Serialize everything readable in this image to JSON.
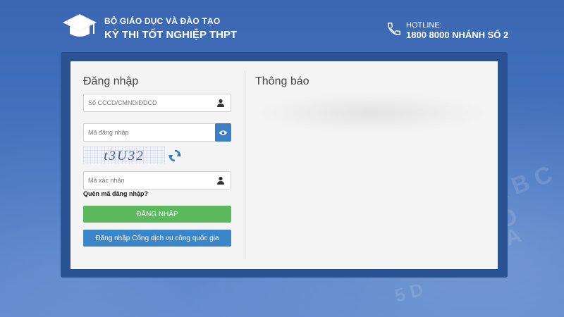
{
  "header": {
    "org": "BỘ GIÁO DỤC VÀ ĐÀO TẠO",
    "exam": "KỲ THI TỐT NGHIỆP THPT",
    "hotline_label": "HOTLINE:",
    "hotline_number": "1800 8000 NHÁNH SỐ 2"
  },
  "login": {
    "title": "Đăng nhập",
    "id_placeholder": "Số CCCD/CMND/ĐDCD",
    "password_placeholder": "Mã đăng nhập",
    "captcha_text": "t3U32",
    "captcha_placeholder": "Mã xác nhận",
    "forgot_label": "Quên mã đăng nhập?",
    "login_button": "ĐĂNG NHẬP",
    "gov_login_button": "Đăng nhập Cổng dịch vụ công quốc gia"
  },
  "notice": {
    "title": "Thông báo"
  },
  "icons": {
    "logo": "graduation-cap-icon",
    "phone": "phone-icon",
    "user": "user-icon",
    "eye": "eye-icon",
    "refresh": "refresh-icon"
  },
  "colors": {
    "background": "#3f6db8",
    "frame": "#2a5394",
    "login_button": "#5cb85c",
    "gov_button": "#3b86c8"
  }
}
